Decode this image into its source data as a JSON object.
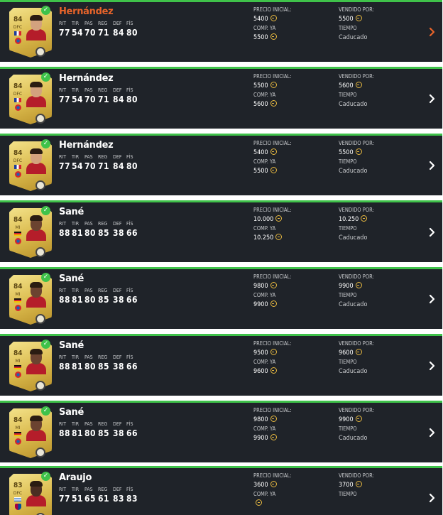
{
  "labels": {
    "stats": [
      "RIT",
      "TIR",
      "PAS",
      "REG",
      "DEF",
      "FÍS"
    ],
    "initial_price": "PRECIO INICIAL:",
    "buy_now": "COMP. YA",
    "sold_for": "VENDIDO POR:",
    "time": "TIEMPO"
  },
  "colors": {
    "accent_green": "#3fc24a",
    "active_orange": "#e8642a",
    "row_bg": "#1f2329",
    "coin_gold": "#e5b740"
  },
  "rows": [
    {
      "name": "Hernández",
      "active": true,
      "rating": "84",
      "position": "DFC",
      "flag": "fr",
      "club": "bay",
      "skin": "#d3a27e",
      "stats": [
        "77",
        "54",
        "70",
        "71",
        "84",
        "80"
      ],
      "initial_price": "5400",
      "buy_now": "5500",
      "sold_for": "5500",
      "status": "Caducado"
    },
    {
      "name": "Hernández",
      "active": false,
      "rating": "84",
      "position": "DFC",
      "flag": "fr",
      "club": "bay",
      "skin": "#d3a27e",
      "stats": [
        "77",
        "54",
        "70",
        "71",
        "84",
        "80"
      ],
      "initial_price": "5500",
      "buy_now": "5600",
      "sold_for": "5600",
      "status": "Caducado"
    },
    {
      "name": "Hernández",
      "active": false,
      "rating": "84",
      "position": "DFC",
      "flag": "fr",
      "club": "bay",
      "skin": "#d3a27e",
      "stats": [
        "77",
        "54",
        "70",
        "71",
        "84",
        "80"
      ],
      "initial_price": "5400",
      "buy_now": "5500",
      "sold_for": "5500",
      "status": "Caducado"
    },
    {
      "name": "Sané",
      "active": false,
      "rating": "84",
      "position": "MI",
      "flag": "de",
      "club": "bay",
      "skin": "#6b4330",
      "stats": [
        "88",
        "81",
        "80",
        "85",
        "38",
        "66"
      ],
      "initial_price": "10.000",
      "buy_now": "10.250",
      "sold_for": "10.250",
      "status": "Caducado"
    },
    {
      "name": "Sané",
      "active": false,
      "rating": "84",
      "position": "MI",
      "flag": "de",
      "club": "bay",
      "skin": "#6b4330",
      "stats": [
        "88",
        "81",
        "80",
        "85",
        "38",
        "66"
      ],
      "initial_price": "9800",
      "buy_now": "9900",
      "sold_for": "9900",
      "status": "Caducado"
    },
    {
      "name": "Sané",
      "active": false,
      "rating": "84",
      "position": "MI",
      "flag": "de",
      "club": "bay",
      "skin": "#6b4330",
      "stats": [
        "88",
        "81",
        "80",
        "85",
        "38",
        "66"
      ],
      "initial_price": "9500",
      "buy_now": "9600",
      "sold_for": "9600",
      "status": "Caducado"
    },
    {
      "name": "Sané",
      "active": false,
      "rating": "84",
      "position": "MI",
      "flag": "de",
      "club": "bay",
      "skin": "#6b4330",
      "stats": [
        "88",
        "81",
        "80",
        "85",
        "38",
        "66"
      ],
      "initial_price": "9800",
      "buy_now": "9900",
      "sold_for": "9900",
      "status": "Caducado"
    },
    {
      "name": "Araujo",
      "active": false,
      "rating": "83",
      "position": "DFC",
      "flag": "uy",
      "club": "bar",
      "skin": "#4a2e22",
      "stats": [
        "77",
        "51",
        "65",
        "61",
        "83",
        "83"
      ],
      "initial_price": "3600",
      "buy_now": "",
      "sold_for": "3700",
      "status": ""
    }
  ]
}
